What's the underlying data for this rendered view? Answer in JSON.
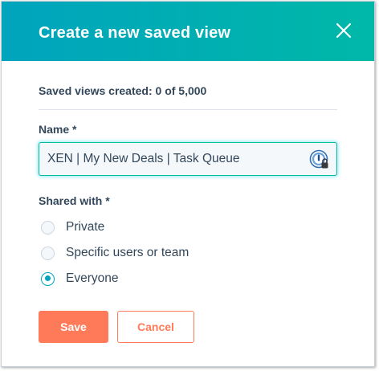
{
  "dialog": {
    "title": "Create a new saved view",
    "close_icon": "close-icon",
    "counter_text": "Saved views created: 0 of 5,000"
  },
  "name_field": {
    "label": "Name *",
    "value": "XEN | My New Deals | Task Queue",
    "icon": "password-manager-icon"
  },
  "shared_with": {
    "label": "Shared with *",
    "options": [
      {
        "label": "Private",
        "selected": false
      },
      {
        "label": "Specific users or team",
        "selected": false
      },
      {
        "label": "Everyone",
        "selected": true
      }
    ]
  },
  "actions": {
    "save_label": "Save",
    "cancel_label": "Cancel"
  },
  "colors": {
    "header_start": "#00a4bd",
    "header_end": "#00b8a8",
    "primary_button": "#ff7a59",
    "radio_checked": "#00a4bd",
    "text": "#33475b"
  }
}
